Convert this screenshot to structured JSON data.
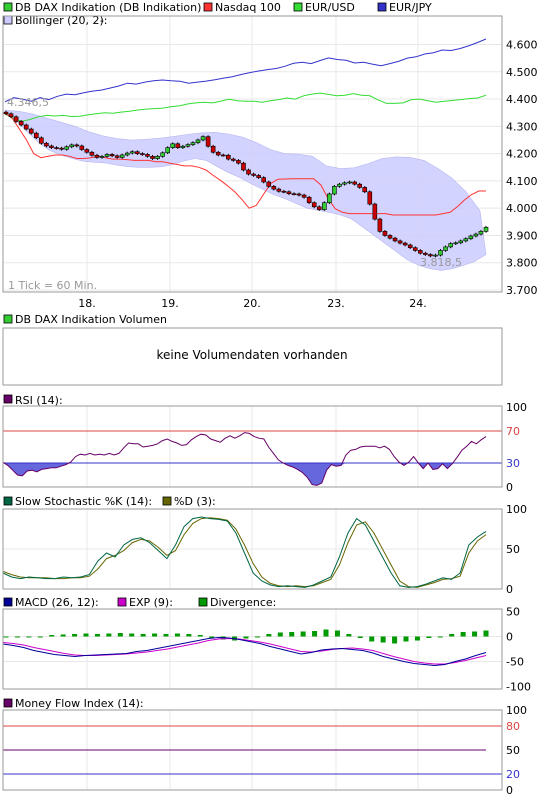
{
  "price_panel": {
    "legend": {
      "dax": "DB DAX Indikation (DB Indikation)",
      "nasdaq": "Nasdaq 100",
      "eurusd": "EUR/USD",
      "eurjpy": "EUR/JPY",
      "bollinger": "Bollinger (20, 2):",
      "bollinger_value": "-"
    },
    "max_label": "4.346,5",
    "min_label": "3.818,5",
    "tick_label": "1 Tick = 60 Min."
  },
  "volume_panel": {
    "legend": "DB DAX Indikation Volumen",
    "message": "keine Volumendaten vorhanden"
  },
  "rsi_panel": {
    "legend": "RSI (14):"
  },
  "stoch_panel": {
    "legend_k": "Slow Stochastic %K (14):",
    "legend_d": "%D (3):"
  },
  "macd_panel": {
    "legend_macd": "MACD (26, 12):",
    "legend_exp": "EXP (9):",
    "legend_div": "Divergence:"
  },
  "mfi_panel": {
    "legend": "Money Flow Index (14):"
  },
  "colors": {
    "dax_up": "#33cc33",
    "dax_down": "#cc0000",
    "nasdaq": "#ff3333",
    "eurusd": "#33dd33",
    "eurjpy": "#3333cc",
    "bollinger_fill": "#ccccff",
    "rsi": "#660066",
    "rsi_fill": "#6666dd",
    "stoch_k": "#006644",
    "stoch_d": "#666600",
    "macd": "#000099",
    "exp": "#cc00cc",
    "divergence": "#009900",
    "mfi": "#660066",
    "level_red": "#dd4444",
    "level_blue": "#3333cc",
    "grid": "#e8e8e8"
  },
  "chart_data": [
    {
      "type": "line",
      "title": "DB DAX Indikation (DB Indikation)",
      "x_tick_labels": [
        "18.",
        "19.",
        "20.",
        "23.",
        "24."
      ],
      "y_ticks": [
        3700,
        3800,
        3900,
        4000,
        4100,
        4200,
        4300,
        4400,
        4500,
        4600
      ],
      "y_tick_labels": [
        "3.700",
        "3.800",
        "3.900",
        "4.000",
        "4.100",
        "4.200",
        "4.300",
        "4.400",
        "4.500",
        "4.600"
      ],
      "ylim": [
        3690,
        4660
      ],
      "dax_candles_close": [
        4346,
        4335,
        4318,
        4305,
        4290,
        4275,
        4258,
        4238,
        4228,
        4222,
        4220,
        4216,
        4225,
        4232,
        4228,
        4215,
        4205,
        4194,
        4186,
        4190,
        4197,
        4192,
        4186,
        4195,
        4202,
        4207,
        4200,
        4197,
        4190,
        4182,
        4190,
        4203,
        4222,
        4236,
        4222,
        4227,
        4233,
        4240,
        4250,
        4262,
        4227,
        4205,
        4195,
        4194,
        4180,
        4175,
        4165,
        4140,
        4125,
        4120,
        4112,
        4096,
        4080,
        4070,
        4062,
        4060,
        4053,
        4052,
        4048,
        4040,
        4020,
        4005,
        3995,
        4020,
        4052,
        4080,
        4088,
        4093,
        4096,
        4088,
        4076,
        4060,
        4015,
        3960,
        3915,
        3900,
        3890,
        3880,
        3872,
        3865,
        3855,
        3845,
        3835,
        3830,
        3825,
        3828,
        3845,
        3858,
        3870,
        3873,
        3880,
        3888,
        3898,
        3905,
        3915,
        3930
      ],
      "series": [
        {
          "name": "Nasdaq 100",
          "values": [
            4350,
            4330,
            4290,
            4250,
            4200,
            4185,
            4190,
            4195,
            4195,
            4190,
            4182,
            4182,
            4185,
            4190,
            4185,
            4180,
            4180,
            4178,
            4175,
            4175,
            4175,
            4170,
            4170,
            4165,
            4160,
            4155,
            4155,
            4150,
            4140,
            4120,
            4102,
            4082,
            4060,
            4032,
            4000,
            4010,
            4050,
            4090,
            4106,
            4107,
            4108,
            4108,
            4108,
            4108,
            4085,
            4035,
            3998,
            3985,
            3980,
            3980,
            3980,
            3980,
            3980,
            3980,
            3975,
            3975,
            3975,
            3975,
            3975,
            3975,
            3975,
            3980,
            3985,
            4005,
            4030,
            4050,
            4063,
            4063
          ]
        },
        {
          "name": "EUR/USD",
          "values": [
            4345,
            4330,
            4318,
            4325,
            4335,
            4340,
            4338,
            4340,
            4336,
            4337,
            4342,
            4346,
            4350,
            4348,
            4352,
            4355,
            4360,
            4363,
            4365,
            4367,
            4372,
            4375,
            4382,
            4386,
            4388,
            4386,
            4392,
            4400,
            4394,
            4392,
            4392,
            4388,
            4394,
            4398,
            4404,
            4400,
            4412,
            4418,
            4422,
            4417,
            4412,
            4414,
            4420,
            4414,
            4412,
            4397,
            4384,
            4384,
            4386,
            4398,
            4400,
            4394,
            4388,
            4392,
            4395,
            4398,
            4402,
            4404,
            4414
          ]
        },
        {
          "name": "EUR/JPY",
          "values": [
            4390,
            4405,
            4400,
            4392,
            4405,
            4398,
            4410,
            4418,
            4416,
            4423,
            4429,
            4433,
            4440,
            4448,
            4458,
            4455,
            4462,
            4467,
            4470,
            4467,
            4465,
            4458,
            4462,
            4466,
            4471,
            4477,
            4482,
            4490,
            4497,
            4503,
            4508,
            4512,
            4520,
            4531,
            4535,
            4530,
            4541,
            4551,
            4545,
            4542,
            4532,
            4535,
            4528,
            4522,
            4530,
            4538,
            4550,
            4555,
            4565,
            4570,
            4580,
            4578,
            4585,
            4595,
            4607,
            4620
          ]
        },
        {
          "name": "Bollinger upper",
          "values": [
            4360,
            4355,
            4345,
            4330,
            4315,
            4300,
            4280,
            4265,
            4255,
            4250,
            4252,
            4256,
            4262,
            4270,
            4276,
            4278,
            4272,
            4260,
            4240,
            4215,
            4200,
            4198,
            4190,
            4155,
            4145,
            4148,
            4163,
            4182,
            4188,
            4186,
            4175,
            4145,
            4110,
            4060,
            3990
          ]
        },
        {
          "name": "Bollinger lower",
          "values": [
            4346,
            4320,
            4280,
            4240,
            4212,
            4195,
            4182,
            4172,
            4168,
            4166,
            4158,
            4152,
            4150,
            4150,
            4152,
            4160,
            4173,
            4182,
            4175,
            4152,
            4130,
            4112,
            4090,
            4070,
            4050,
            4035,
            4018,
            4000,
            3992,
            3985,
            3975,
            3960,
            3930,
            3900,
            3870,
            3840,
            3810,
            3790,
            3778,
            3772,
            3778,
            3790,
            3805,
            3830
          ]
        }
      ],
      "annotations": [
        "4.346,5",
        "3.818,5",
        "1 Tick = 60 Min."
      ]
    },
    {
      "type": "area",
      "title": "RSI (14):",
      "y_tick_labels": [
        "0",
        "30",
        "70",
        "100"
      ],
      "levels": [
        30,
        70
      ],
      "ylim": [
        0,
        100
      ],
      "series": [
        {
          "name": "RSI (14)",
          "values": [
            31,
            27,
            21,
            15,
            14,
            20,
            21,
            19,
            22,
            23,
            24,
            24,
            26,
            28,
            31,
            38,
            41,
            40,
            42,
            40,
            41,
            40,
            42,
            40,
            42,
            49,
            55,
            54,
            54,
            50,
            51,
            52,
            54,
            58,
            60,
            57,
            55,
            52,
            53,
            59,
            63,
            66,
            65,
            60,
            58,
            56,
            61,
            64,
            61,
            64,
            68,
            67,
            63,
            61,
            60,
            50,
            42,
            34,
            30,
            27,
            25,
            22,
            18,
            12,
            3,
            2,
            5,
            21,
            28,
            26,
            27,
            40,
            46,
            47,
            50,
            51,
            51,
            51,
            49,
            51,
            47,
            38,
            31,
            27,
            31,
            38,
            30,
            23,
            30,
            22,
            23,
            29,
            23,
            29,
            37,
            46,
            51,
            57,
            54,
            59,
            63
          ]
        }
      ]
    },
    {
      "type": "line",
      "title": "Slow Stochastic %K (14):",
      "y_tick_labels": [
        "0",
        "50",
        "100"
      ],
      "ylim": [
        0,
        100
      ],
      "series": [
        {
          "name": "Slow Stochastic %K (14)",
          "values": [
            20,
            15,
            13,
            15,
            14,
            13,
            13,
            15,
            14,
            15,
            18,
            35,
            45,
            40,
            55,
            62,
            64,
            58,
            48,
            38,
            55,
            78,
            88,
            90,
            88,
            87,
            85,
            70,
            45,
            20,
            10,
            5,
            3,
            4,
            3,
            2,
            5,
            10,
            15,
            40,
            70,
            88,
            80,
            60,
            40,
            20,
            4,
            2,
            3,
            6,
            10,
            14,
            12,
            20,
            55,
            65,
            72
          ]
        },
        {
          "name": "%D (3)",
          "values": [
            22,
            18,
            15,
            14,
            14,
            14,
            13,
            13,
            14,
            14,
            16,
            25,
            38,
            42,
            48,
            58,
            62,
            60,
            52,
            42,
            48,
            68,
            82,
            88,
            89,
            88,
            86,
            75,
            55,
            32,
            15,
            7,
            4,
            3,
            4,
            3,
            4,
            8,
            12,
            30,
            58,
            80,
            84,
            70,
            50,
            30,
            10,
            3,
            2,
            5,
            8,
            12,
            13,
            16,
            45,
            60,
            68
          ]
        }
      ]
    },
    {
      "type": "bar",
      "title": "MACD (26, 12):",
      "y_tick_labels": [
        "-100",
        "-50",
        "0",
        "50"
      ],
      "ylim": [
        -100,
        50
      ],
      "series": [
        {
          "name": "MACD (26, 12)",
          "values": [
            -15,
            -18,
            -22,
            -28,
            -32,
            -36,
            -38,
            -40,
            -38,
            -37,
            -36,
            -35,
            -34,
            -30,
            -28,
            -24,
            -20,
            -16,
            -12,
            -8,
            -4,
            -2,
            -3,
            -6,
            -10,
            -14,
            -20,
            -25,
            -30,
            -35,
            -32,
            -27,
            -25,
            -24,
            -26,
            -28,
            -33,
            -40,
            -45,
            -50,
            -54,
            -56,
            -58,
            -56,
            -50,
            -45,
            -38,
            -32
          ]
        },
        {
          "name": "EXP (9)",
          "values": [
            -12,
            -14,
            -17,
            -22,
            -26,
            -30,
            -34,
            -37,
            -38,
            -38,
            -37,
            -36,
            -35,
            -33,
            -31,
            -28,
            -25,
            -21,
            -17,
            -13,
            -8,
            -5,
            -4,
            -5,
            -8,
            -11,
            -15,
            -20,
            -25,
            -30,
            -31,
            -29,
            -26,
            -24,
            -23,
            -25,
            -28,
            -34,
            -40,
            -45,
            -50,
            -53,
            -55,
            -55,
            -52,
            -48,
            -43,
            -38
          ]
        },
        {
          "name": "Divergence",
          "values": [
            -1,
            -2,
            -2,
            0,
            3,
            4,
            5,
            6,
            5,
            6,
            7,
            6,
            5,
            6,
            5,
            6,
            5,
            3,
            -3,
            -6,
            -8,
            -4,
            -1,
            5,
            8,
            9,
            10,
            11,
            14,
            12,
            5,
            -3,
            -10,
            -12,
            -14,
            -10,
            -8,
            -3,
            0,
            5,
            9,
            10,
            12
          ]
        }
      ]
    },
    {
      "type": "line",
      "title": "Money Flow Index (14):",
      "y_tick_labels": [
        "0",
        "20",
        "50",
        "80",
        "100"
      ],
      "levels": [
        20,
        80
      ],
      "ylim": [
        0,
        100
      ],
      "series": [
        {
          "name": "Money Flow Index (14)",
          "values": [
            50,
            50
          ]
        }
      ]
    }
  ]
}
